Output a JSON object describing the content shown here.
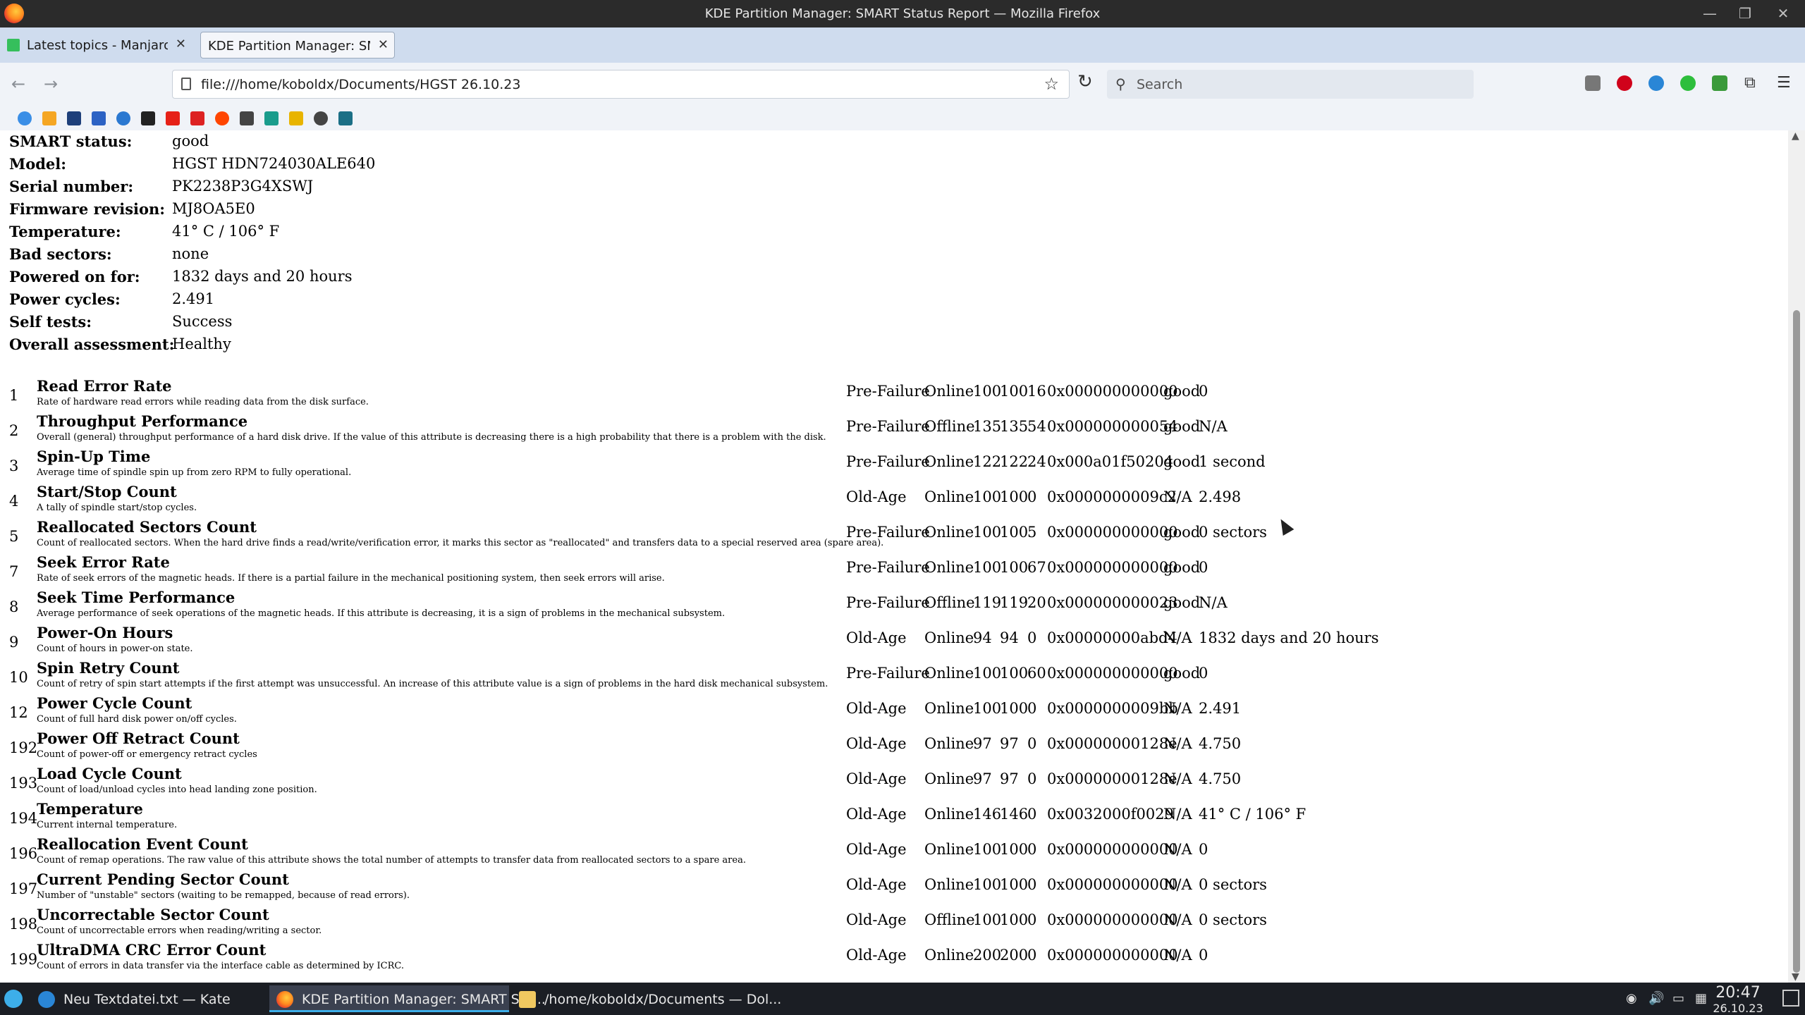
{
  "window": {
    "title": "KDE Partition Manager: SMART Status Report — Mozilla Firefox"
  },
  "tabs": [
    {
      "label": "Latest topics - Manjaro Lin",
      "active": false
    },
    {
      "label": "KDE Partition Manager: SMAR",
      "active": true
    }
  ],
  "nav": {
    "url": "file:///home/koboldx/Documents/HGST 26.10.23",
    "search_placeholder": "Search"
  },
  "summary": [
    {
      "key": "SMART status:",
      "value": "good"
    },
    {
      "key": "Model:",
      "value": "HGST HDN724030ALE640"
    },
    {
      "key": "Serial number:",
      "value": "PK2238P3G4XSWJ"
    },
    {
      "key": "Firmware revision:",
      "value": "MJ8OA5E0"
    },
    {
      "key": "Temperature:",
      "value": "41° C / 106° F"
    },
    {
      "key": "Bad sectors:",
      "value": "none"
    },
    {
      "key": "Powered on for:",
      "value": "1832 days and 20 hours"
    },
    {
      "key": "Power cycles:",
      "value": "2.491"
    },
    {
      "key": "Self tests:",
      "value": "Success"
    },
    {
      "key": "Overall assessment:",
      "value": "Healthy"
    }
  ],
  "attributes": [
    {
      "id": "1",
      "name": "Read Error Rate",
      "desc": "Rate of hardware read errors while reading data from the disk surface.",
      "type": "Pre-Failure",
      "update": "Online",
      "value": "100",
      "worst": "100",
      "thresh": "16",
      "raw": "0x000000000000",
      "assess": "good",
      "display": "0"
    },
    {
      "id": "2",
      "name": "Throughput Performance",
      "desc": "Overall (general) throughput performance of a hard disk drive. If the value of this attribute is decreasing there is a high probability that there is a problem with the disk.",
      "type": "Pre-Failure",
      "update": "Offline",
      "value": "135",
      "worst": "135",
      "thresh": "54",
      "raw": "0x000000000054",
      "assess": "good",
      "display": "N/A"
    },
    {
      "id": "3",
      "name": "Spin-Up Time",
      "desc": "Average time of spindle spin up from zero RPM to fully operational.",
      "type": "Pre-Failure",
      "update": "Online",
      "value": "122",
      "worst": "122",
      "thresh": "24",
      "raw": "0x000a01f50204",
      "assess": "good",
      "display": "1 second"
    },
    {
      "id": "4",
      "name": "Start/Stop Count",
      "desc": "A tally of spindle start/stop cycles.",
      "type": "Old-Age",
      "update": "Online",
      "value": "100",
      "worst": "100",
      "thresh": "0",
      "raw": "0x0000000009c2",
      "assess": "N/A",
      "display": "2.498"
    },
    {
      "id": "5",
      "name": "Reallocated Sectors Count",
      "desc": "Count of reallocated sectors. When the hard drive finds a read/write/verification error, it marks this sector as \"reallocated\" and transfers data to a special reserved area (spare area).",
      "type": "Pre-Failure",
      "update": "Online",
      "value": "100",
      "worst": "100",
      "thresh": "5",
      "raw": "0x000000000000",
      "assess": "good",
      "display": "0 sectors"
    },
    {
      "id": "7",
      "name": "Seek Error Rate",
      "desc": "Rate of seek errors of the magnetic heads. If there is a partial failure in the mechanical positioning system, then seek errors will arise.",
      "type": "Pre-Failure",
      "update": "Online",
      "value": "100",
      "worst": "100",
      "thresh": "67",
      "raw": "0x000000000000",
      "assess": "good",
      "display": "0"
    },
    {
      "id": "8",
      "name": "Seek Time Performance",
      "desc": "Average performance of seek operations of the magnetic heads. If this attribute is decreasing, it is a sign of problems in the mechanical subsystem.",
      "type": "Pre-Failure",
      "update": "Offline",
      "value": "119",
      "worst": "119",
      "thresh": "20",
      "raw": "0x000000000023",
      "assess": "good",
      "display": "N/A"
    },
    {
      "id": "9",
      "name": "Power-On Hours",
      "desc": "Count of hours in power-on state.",
      "type": "Old-Age",
      "update": "Online",
      "value": "94",
      "worst": "94",
      "thresh": "0",
      "raw": "0x00000000abd4",
      "assess": "N/A",
      "display": "1832 days and 20 hours"
    },
    {
      "id": "10",
      "name": "Spin Retry Count",
      "desc": "Count of retry of spin start attempts if the first attempt was unsuccessful. An increase of this attribute value is a sign of problems in the hard disk mechanical subsystem.",
      "type": "Pre-Failure",
      "update": "Online",
      "value": "100",
      "worst": "100",
      "thresh": "60",
      "raw": "0x000000000000",
      "assess": "good",
      "display": "0"
    },
    {
      "id": "12",
      "name": "Power Cycle Count",
      "desc": "Count of full hard disk power on/off cycles.",
      "type": "Old-Age",
      "update": "Online",
      "value": "100",
      "worst": "100",
      "thresh": "0",
      "raw": "0x0000000009bb",
      "assess": "N/A",
      "display": "2.491"
    },
    {
      "id": "192",
      "name": "Power Off Retract Count",
      "desc": "Count of power-off or emergency retract cycles",
      "type": "Old-Age",
      "update": "Online",
      "value": "97",
      "worst": "97",
      "thresh": "0",
      "raw": "0x00000000128e",
      "assess": "N/A",
      "display": "4.750"
    },
    {
      "id": "193",
      "name": "Load Cycle Count",
      "desc": "Count of load/unload cycles into head landing zone position.",
      "type": "Old-Age",
      "update": "Online",
      "value": "97",
      "worst": "97",
      "thresh": "0",
      "raw": "0x00000000128e",
      "assess": "N/A",
      "display": "4.750"
    },
    {
      "id": "194",
      "name": "Temperature",
      "desc": "Current internal temperature.",
      "type": "Old-Age",
      "update": "Online",
      "value": "146",
      "worst": "146",
      "thresh": "0",
      "raw": "0x0032000f0029",
      "assess": "N/A",
      "display": "41° C / 106° F"
    },
    {
      "id": "196",
      "name": "Reallocation Event Count",
      "desc": "Count of remap operations. The raw value of this attribute shows the total number of attempts to transfer data from reallocated sectors to a spare area.",
      "type": "Old-Age",
      "update": "Online",
      "value": "100",
      "worst": "100",
      "thresh": "0",
      "raw": "0x000000000000",
      "assess": "N/A",
      "display": "0"
    },
    {
      "id": "197",
      "name": "Current Pending Sector Count",
      "desc": "Number of \"unstable\" sectors (waiting to be remapped, because of read errors).",
      "type": "Old-Age",
      "update": "Online",
      "value": "100",
      "worst": "100",
      "thresh": "0",
      "raw": "0x000000000000",
      "assess": "N/A",
      "display": "0 sectors"
    },
    {
      "id": "198",
      "name": "Uncorrectable Sector Count",
      "desc": "Count of uncorrectable errors when reading/writing a sector.",
      "type": "Old-Age",
      "update": "Offline",
      "value": "100",
      "worst": "100",
      "thresh": "0",
      "raw": "0x000000000000",
      "assess": "N/A",
      "display": "0 sectors"
    },
    {
      "id": "199",
      "name": "UltraDMA CRC Error Count",
      "desc": "Count of errors in data transfer via the interface cable as determined by ICRC.",
      "type": "Old-Age",
      "update": "Online",
      "value": "200",
      "worst": "200",
      "thresh": "0",
      "raw": "0x000000000000",
      "assess": "N/A",
      "display": "0"
    }
  ],
  "taskbar": {
    "tasks": [
      {
        "label": "Neu Textdatei.txt — Kate",
        "icon": "kate-icon",
        "active": false
      },
      {
        "label": "KDE Partition Manager: SMART Sta...",
        "icon": "firefox-icon",
        "active": true
      },
      {
        "label": "/home/koboldx/Documents — Dol...",
        "icon": "folder-icon",
        "active": false
      }
    ],
    "time": "20:47",
    "date": "26.10.23"
  },
  "colors": {
    "titlebar": "#2b2b2b",
    "tabbar": "#cfdcee",
    "toolbar": "#f0f3f8",
    "taskbar": "#1b1e24",
    "accent": "#3daee9"
  }
}
